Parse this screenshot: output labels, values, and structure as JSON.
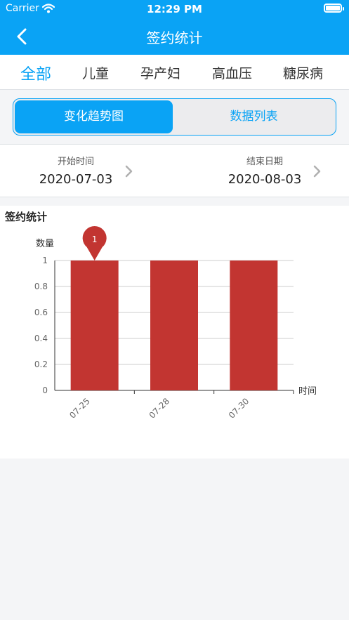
{
  "status_bar": {
    "carrier": "Carrier",
    "time": "12:29 PM",
    "battery_level": 1.0
  },
  "nav": {
    "title": "签约统计",
    "back_icon": "chevron-left-icon"
  },
  "category_tabs": [
    {
      "label": "全部",
      "active": true
    },
    {
      "label": "儿童",
      "active": false
    },
    {
      "label": "孕产妇",
      "active": false
    },
    {
      "label": "高血压",
      "active": false
    },
    {
      "label": "糖尿病",
      "active": false
    }
  ],
  "segments": {
    "trend": "变化趋势图",
    "list": "数据列表",
    "selected": "trend"
  },
  "date_range": {
    "start_label": "开始时间",
    "start_value": "2020-07-03",
    "end_label": "结束日期",
    "end_value": "2020-08-03"
  },
  "colors": {
    "accent": "#0aa3f5",
    "bar": "#c23531",
    "grid": "#cccccc"
  },
  "chart_title": "签约统计",
  "chart_data": {
    "type": "bar",
    "categories": [
      "07-25",
      "07-28",
      "07-30"
    ],
    "values": [
      1,
      1,
      1
    ],
    "ylabel": "数量",
    "xlabel": "时间",
    "ylim": [
      0,
      1
    ],
    "y_ticks": [
      0,
      0.2,
      0.4,
      0.6,
      0.8,
      1
    ],
    "grid": true,
    "max_marker": {
      "category": "07-25",
      "value": 1,
      "label": "1"
    }
  }
}
